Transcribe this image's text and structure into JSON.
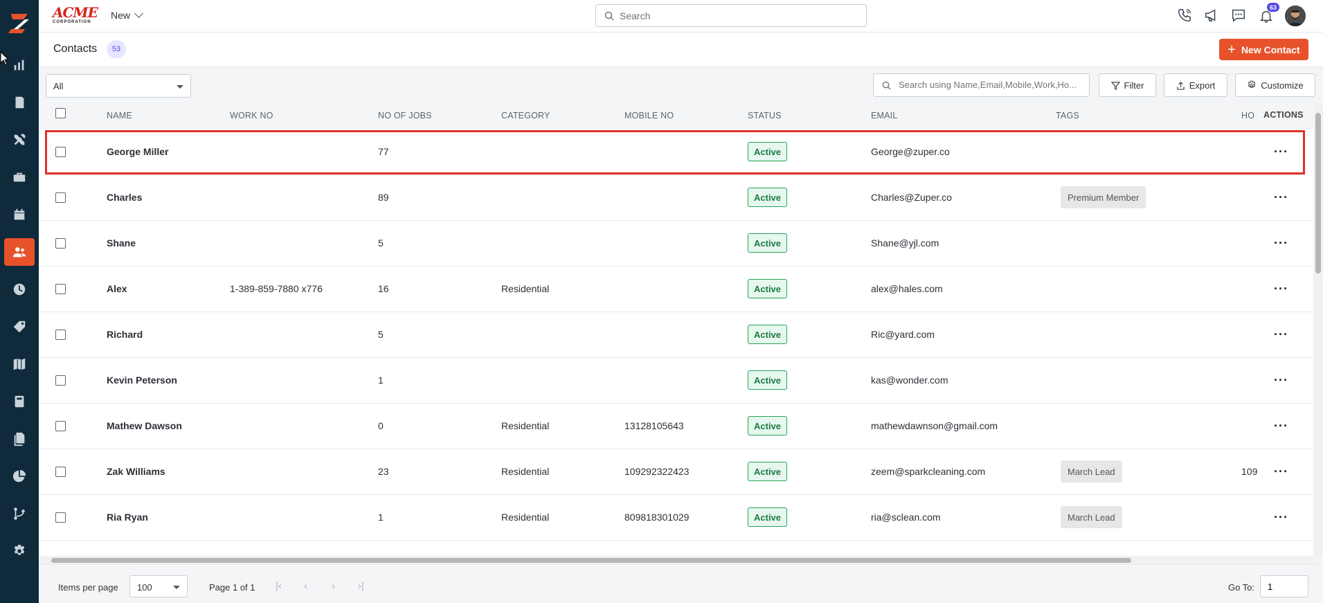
{
  "brand": {
    "name": "ACME",
    "tagline": "CORPORATION"
  },
  "topbar": {
    "new_label": "New",
    "search_placeholder": "Search",
    "notification_count": "63"
  },
  "page": {
    "title": "Contacts",
    "count": "53",
    "new_button": "New Contact"
  },
  "toolbar": {
    "filter_value": "All",
    "search_placeholder": "Search using Name,Email,Mobile,Work,Ho...",
    "filter_label": "Filter",
    "export_label": "Export",
    "customize_label": "Customize"
  },
  "table": {
    "headers": {
      "name": "NAME",
      "work_no": "WORK NO",
      "jobs": "NO OF JOBS",
      "category": "CATEGORY",
      "mobile": "MOBILE NO",
      "status": "STATUS",
      "email": "EMAIL",
      "tags": "TAGS",
      "home": "HO",
      "actions": "ACTIONS"
    },
    "rows": [
      {
        "name": "George Miller",
        "work_no": "",
        "jobs": "77",
        "category": "",
        "mobile": "",
        "status": "Active",
        "email": "George@zuper.co",
        "tag": "",
        "home": ""
      },
      {
        "name": "Charles",
        "work_no": "",
        "jobs": "89",
        "category": "",
        "mobile": "",
        "status": "Active",
        "email": "Charles@Zuper.co",
        "tag": "Premium Member",
        "home": ""
      },
      {
        "name": "Shane",
        "work_no": "",
        "jobs": "5",
        "category": "",
        "mobile": "",
        "status": "Active",
        "email": "Shane@yjl.com",
        "tag": "",
        "home": ""
      },
      {
        "name": "Alex",
        "work_no": "1-389-859-7880 x776",
        "jobs": "16",
        "category": "Residential",
        "mobile": "",
        "status": "Active",
        "email": "alex@hales.com",
        "tag": "",
        "home": ""
      },
      {
        "name": "Richard",
        "work_no": "",
        "jobs": "5",
        "category": "",
        "mobile": "",
        "status": "Active",
        "email": "Ric@yard.com",
        "tag": "",
        "home": ""
      },
      {
        "name": "Kevin Peterson",
        "work_no": "",
        "jobs": "1",
        "category": "",
        "mobile": "",
        "status": "Active",
        "email": "kas@wonder.com",
        "tag": "",
        "home": ""
      },
      {
        "name": "Mathew Dawson",
        "work_no": "",
        "jobs": "0",
        "category": "Residential",
        "mobile": "13128105643",
        "status": "Active",
        "email": "mathewdawnson@gmail.com",
        "tag": "",
        "home": ""
      },
      {
        "name": "Zak Williams",
        "work_no": "",
        "jobs": "23",
        "category": "Residential",
        "mobile": "109292322423",
        "status": "Active",
        "email": "zeem@sparkcleaning.com",
        "tag": "March Lead",
        "home": "109"
      },
      {
        "name": "Ria Ryan",
        "work_no": "",
        "jobs": "1",
        "category": "Residential",
        "mobile": "809818301029",
        "status": "Active",
        "email": "ria@sclean.com",
        "tag": "March Lead",
        "home": ""
      }
    ]
  },
  "footer": {
    "items_per_page_label": "Items per page",
    "items_per_page_value": "100",
    "page_info": "Page 1 of 1",
    "goto_label": "Go To:",
    "goto_value": "1"
  },
  "colors": {
    "accent": "#e8522a",
    "sidebar": "#0e2a3b",
    "status_green": "#23a35a",
    "badge_purple": "#5048e5",
    "highlight": "#e0302a"
  },
  "icons": [
    "dashboard-icon",
    "jobs-icon",
    "tools-icon",
    "briefcase-icon",
    "calendar-icon",
    "contacts-icon",
    "clock-icon",
    "tag-icon",
    "map-icon",
    "calculator-icon",
    "documents-icon",
    "pie-chart-icon",
    "workflow-icon",
    "settings-icon"
  ]
}
